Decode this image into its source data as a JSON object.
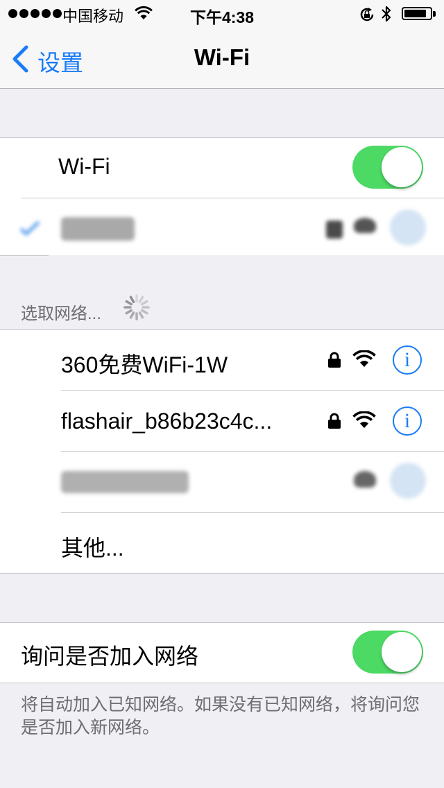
{
  "status_bar": {
    "carrier": "中国移动",
    "time": "下午4:38",
    "signal_dots": 5,
    "battery_level": 0.85,
    "icons": [
      "signal-dots-icon",
      "wifi-icon",
      "rotation-lock-icon",
      "bluetooth-icon",
      "battery-icon"
    ]
  },
  "nav": {
    "back_label": "设置",
    "title": "Wi-Fi"
  },
  "wifi_toggle": {
    "label": "Wi-Fi",
    "on": true
  },
  "connected_network": {
    "name": "",
    "checked": true
  },
  "choose_network": {
    "header": "选取网络..."
  },
  "networks": [
    {
      "name": "360免费WiFi-1W",
      "locked": true,
      "info_label": "i"
    },
    {
      "name": "flashair_b86b23c4c...",
      "locked": true,
      "info_label": "i"
    },
    {
      "name": "",
      "locked": false,
      "info_label": "i"
    }
  ],
  "other": {
    "label": "其他..."
  },
  "ask_join": {
    "label": "询问是否加入网络",
    "on": true,
    "footer": "将自动加入已知网络。如果没有已知网络，将询问您是否加入新网络。"
  },
  "colors": {
    "accent": "#1a7cf6",
    "toggle_on": "#4cd964",
    "background": "#efeff4"
  }
}
